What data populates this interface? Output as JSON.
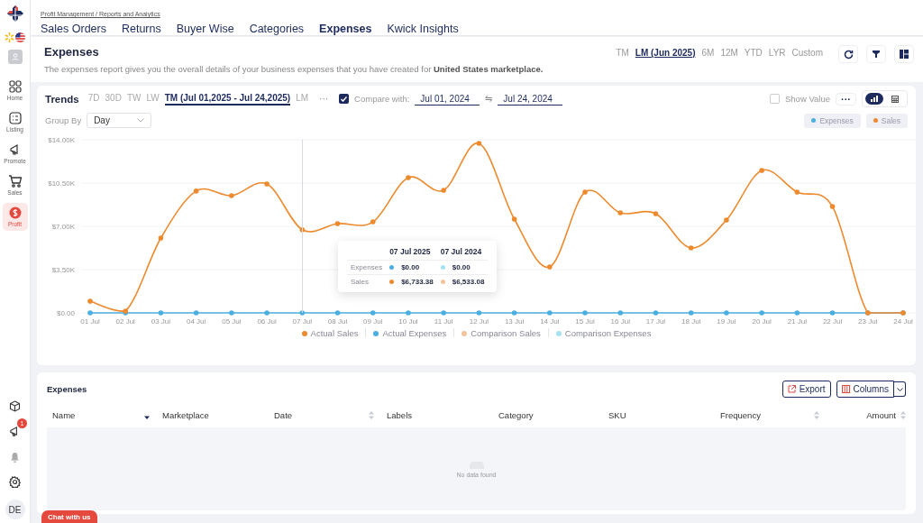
{
  "sidebar": {
    "items": [
      {
        "label": "Home",
        "selected": false
      },
      {
        "label": "Listing",
        "selected": false
      },
      {
        "label": "Promote",
        "selected": false
      },
      {
        "label": "Sales",
        "selected": false
      },
      {
        "label": "Profit",
        "selected": true
      }
    ],
    "notification_count": "1",
    "user_initials": "DE"
  },
  "breadcrumb": "Profit Management / Reports and Analytics",
  "tabs": [
    {
      "label": "Sales Orders",
      "selected": false
    },
    {
      "label": "Returns",
      "selected": false
    },
    {
      "label": "Buyer Wise",
      "selected": false
    },
    {
      "label": "Categories",
      "selected": false
    },
    {
      "label": "Expenses",
      "selected": true
    },
    {
      "label": "Kwick Insights",
      "selected": false
    }
  ],
  "report": {
    "title": "Expenses",
    "description": "The expenses report gives you the overall details of your business expenses that you have created for **United States marketplace.**",
    "periods": [
      {
        "label": "TM",
        "selected": false
      },
      {
        "label": "LM (Jun 2025)",
        "selected": true
      },
      {
        "label": "6M",
        "selected": false
      },
      {
        "label": "12M",
        "selected": false
      },
      {
        "label": "YTD",
        "selected": false
      },
      {
        "label": "LYR",
        "selected": false
      },
      {
        "label": "Custom",
        "selected": false
      }
    ]
  },
  "trends": {
    "title": "Trends",
    "ranges": [
      {
        "label": "7D",
        "selected": false
      },
      {
        "label": "30D",
        "selected": false
      },
      {
        "label": "TW",
        "selected": false
      },
      {
        "label": "LW",
        "selected": false
      },
      {
        "label": "TM (Jul 01,2025 - Jul 24,2025)",
        "selected": true
      },
      {
        "label": "LM",
        "selected": false
      }
    ],
    "more": "···",
    "compare": {
      "checked": true,
      "label": "Compare with:",
      "from": "Jul 01, 2024",
      "swap": "⇋",
      "to": "Jul 24, 2024"
    },
    "show_value": {
      "checked": false,
      "label": "Show Value"
    },
    "options": "···",
    "views": [
      {
        "kind": "chart",
        "selected": true
      },
      {
        "kind": "table",
        "selected": false
      }
    ],
    "group_by": {
      "label": "Group By",
      "value": "Day"
    },
    "filters": [
      {
        "label": "Expenses",
        "color": "#4aaee0"
      },
      {
        "label": "Sales",
        "color": "#ee8a2e"
      }
    ],
    "chart_data": {
      "type": "line",
      "categories": [
        "01 Jul",
        "02 Jul",
        "03 Jul",
        "04 Jul",
        "05 Jul",
        "06 Jul",
        "07 Jul",
        "08 Jul",
        "09 Jul",
        "10 Jul",
        "11 Jul",
        "12 Jul",
        "13 Jul",
        "14 Jul",
        "15 Jul",
        "16 Jul",
        "17 Jul",
        "18 Jul",
        "19 Jul",
        "20 Jul",
        "21 Jul",
        "22 Jul",
        "23 Jul",
        "24 Jul"
      ],
      "ylim": [
        0,
        14000
      ],
      "grid": true,
      "yticks": [
        {
          "value": 0,
          "label": "$0.00"
        },
        {
          "value": 3500,
          "label": "$3.50K"
        },
        {
          "value": 7000,
          "label": "$7.00K"
        },
        {
          "value": 10500,
          "label": "$10.50K"
        },
        {
          "value": 14000,
          "label": "$14.00K"
        }
      ],
      "series": [
        {
          "name": "Actual Sales",
          "color": "#ee8a2e",
          "values": [
            950,
            150,
            6050,
            9850,
            9480,
            10430,
            6730,
            7220,
            7360,
            10940,
            9920,
            13710,
            7580,
            3720,
            9770,
            8090,
            8020,
            5250,
            7510,
            11520,
            9770,
            8600,
            0,
            0
          ]
        },
        {
          "name": "Actual Expenses",
          "color": "#4aaee0",
          "values": [
            0,
            0,
            0,
            0,
            0,
            0,
            0,
            0,
            0,
            0,
            0,
            0,
            0,
            0,
            0,
            0,
            0,
            0,
            0,
            0,
            0,
            0,
            0,
            0
          ]
        },
        {
          "name": "Comparison Sales",
          "color": "#f3c49a",
          "values": [
            null,
            null,
            null,
            null,
            null,
            null,
            null,
            null,
            null,
            null,
            null,
            null,
            null,
            null,
            null,
            null,
            null,
            null,
            null,
            null,
            null,
            null,
            null,
            null
          ]
        },
        {
          "name": "Comparison Expenses",
          "color": "#a6e2f2",
          "values": [
            null,
            null,
            null,
            null,
            null,
            null,
            null,
            null,
            null,
            null,
            null,
            null,
            null,
            null,
            null,
            null,
            null,
            null,
            null,
            null,
            null,
            null,
            null,
            null
          ]
        }
      ]
    },
    "tooltip": {
      "columns": [
        "07 Jul 2025",
        "07 Jul 2024"
      ],
      "rows": [
        {
          "label": "Expenses",
          "values": [
            {
              "text": "$0.00",
              "color": "#4aaee0"
            },
            {
              "text": "$0.00",
              "color": "#a6e2f2"
            }
          ]
        },
        {
          "label": "Sales",
          "values": [
            {
              "text": "$6,733.38",
              "color": "#ee8a2e"
            },
            {
              "text": "$6,533.08",
              "color": "#f3c49a"
            }
          ]
        }
      ]
    }
  },
  "table": {
    "title": "Expenses",
    "buttons": [
      "Export",
      "Columns"
    ],
    "columns": [
      {
        "label": "Name",
        "sortable": true,
        "sorted": true
      },
      {
        "label": "Marketplace",
        "sortable": false
      },
      {
        "label": "Date",
        "sortable": true,
        "sorted": false
      },
      {
        "label": "Labels",
        "sortable": false
      },
      {
        "label": "Category",
        "sortable": false
      },
      {
        "label": "SKU",
        "sortable": false
      },
      {
        "label": "Frequency",
        "sortable": true,
        "sorted": false
      },
      {
        "label": "Amount",
        "sortable": true,
        "sorted": false
      }
    ],
    "empty_message": "No data found"
  },
  "chat_button": "Chat with us"
}
